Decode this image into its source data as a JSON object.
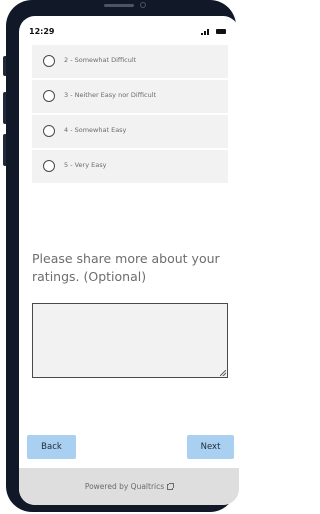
{
  "status_bar": {
    "time": "12:29",
    "signal_icon": "signal-bars-icon",
    "battery_icon": "battery-icon"
  },
  "options": [
    {
      "label": "2 - Somewhat Difficult"
    },
    {
      "label": "3 - Neither Easy nor Difficult"
    },
    {
      "label": "4 - Somewhat Easy"
    },
    {
      "label": "5 - Very Easy"
    }
  ],
  "question": {
    "prompt": "Please share more about your ratings. (Optional)",
    "answer": ""
  },
  "navigation": {
    "back_label": "Back",
    "next_label": "Next"
  },
  "footer": {
    "text": "Powered by Qualtrics",
    "icon": "external-link-icon"
  },
  "colors": {
    "button_bg": "#a9d0f0",
    "option_bg": "#f2f2f2",
    "footer_bg": "#dedede"
  }
}
